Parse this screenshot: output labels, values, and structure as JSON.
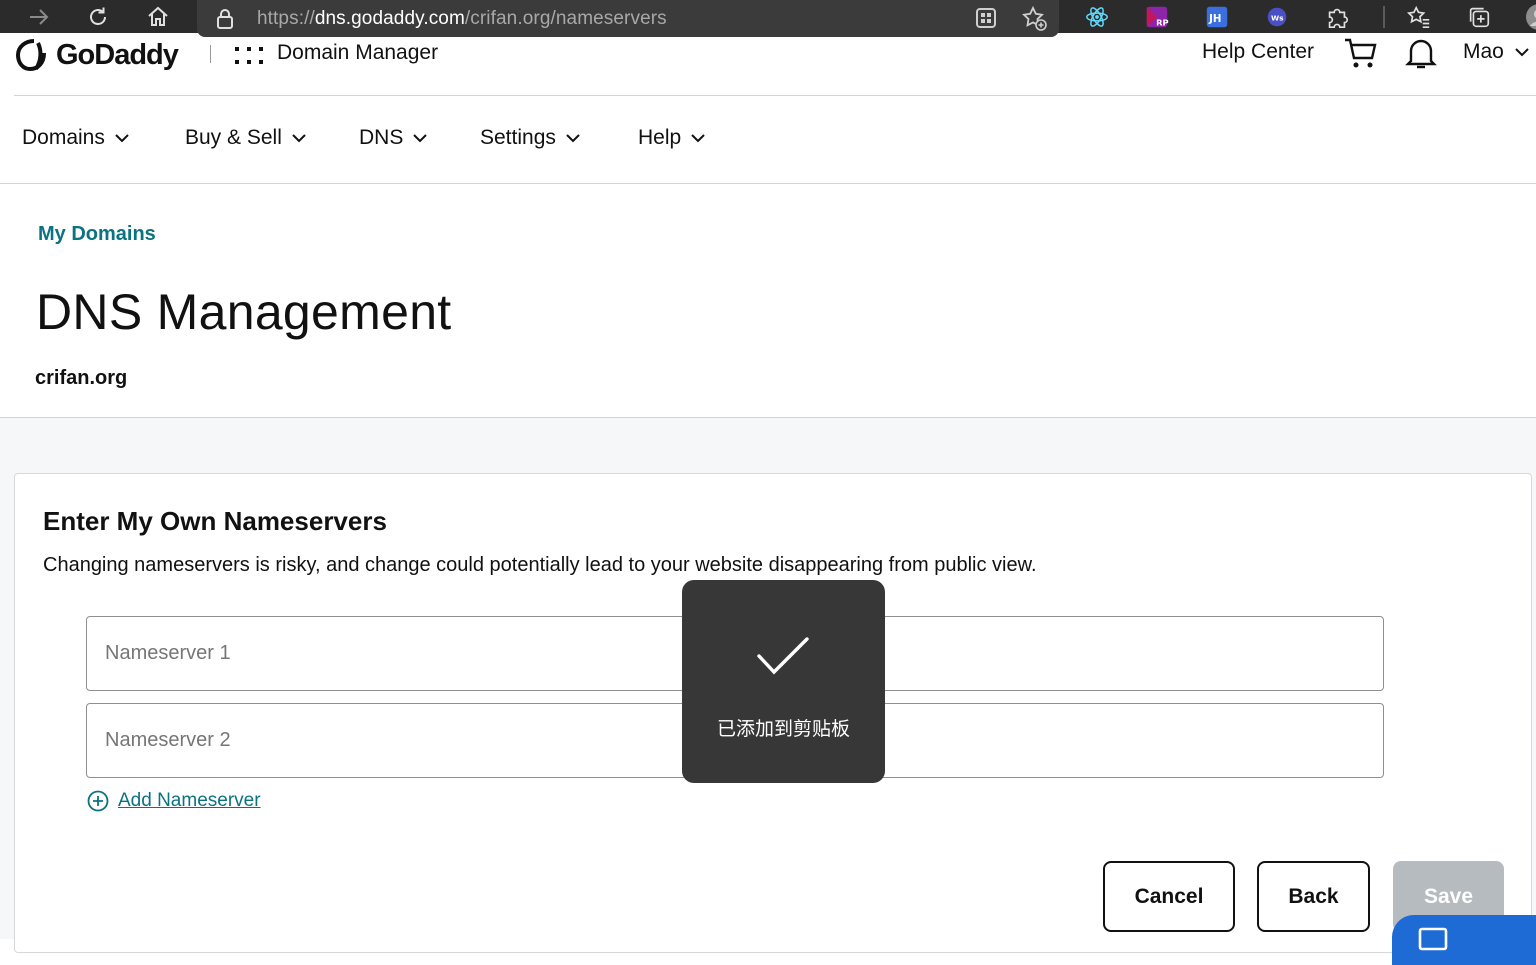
{
  "browser": {
    "url_scheme": "https://",
    "url_host": "dns.godaddy.com",
    "url_path": "/crifan.org/nameservers"
  },
  "header": {
    "brand": "GoDaddy",
    "product": "Domain Manager",
    "help_center": "Help Center",
    "user": "Mao"
  },
  "menu": {
    "items": [
      {
        "label": "Domains"
      },
      {
        "label": "Buy & Sell"
      },
      {
        "label": "DNS"
      },
      {
        "label": "Settings"
      },
      {
        "label": "Help"
      }
    ]
  },
  "page": {
    "breadcrumb": "My Domains",
    "title": "DNS Management",
    "domain": "crifan.org"
  },
  "nameservers": {
    "title": "Enter My Own Nameservers",
    "description": "Changing nameservers is risky, and change could potentially lead to your website disappearing from public view.",
    "fields": [
      {
        "placeholder": "Nameserver 1",
        "value": ""
      },
      {
        "placeholder": "Nameserver 2",
        "value": ""
      }
    ],
    "add_label": "Add Nameserver"
  },
  "actions": {
    "cancel": "Cancel",
    "back": "Back",
    "save": "Save"
  },
  "toast": {
    "message": "已添加到剪贴板",
    "icon": "checkmark-icon"
  },
  "colors": {
    "accent": "#0b7281",
    "chrome_bg": "#2b2b2b",
    "toast_bg": "#373737",
    "save_disabled": "#b6bbbf",
    "chat": "#1e6bd6"
  }
}
